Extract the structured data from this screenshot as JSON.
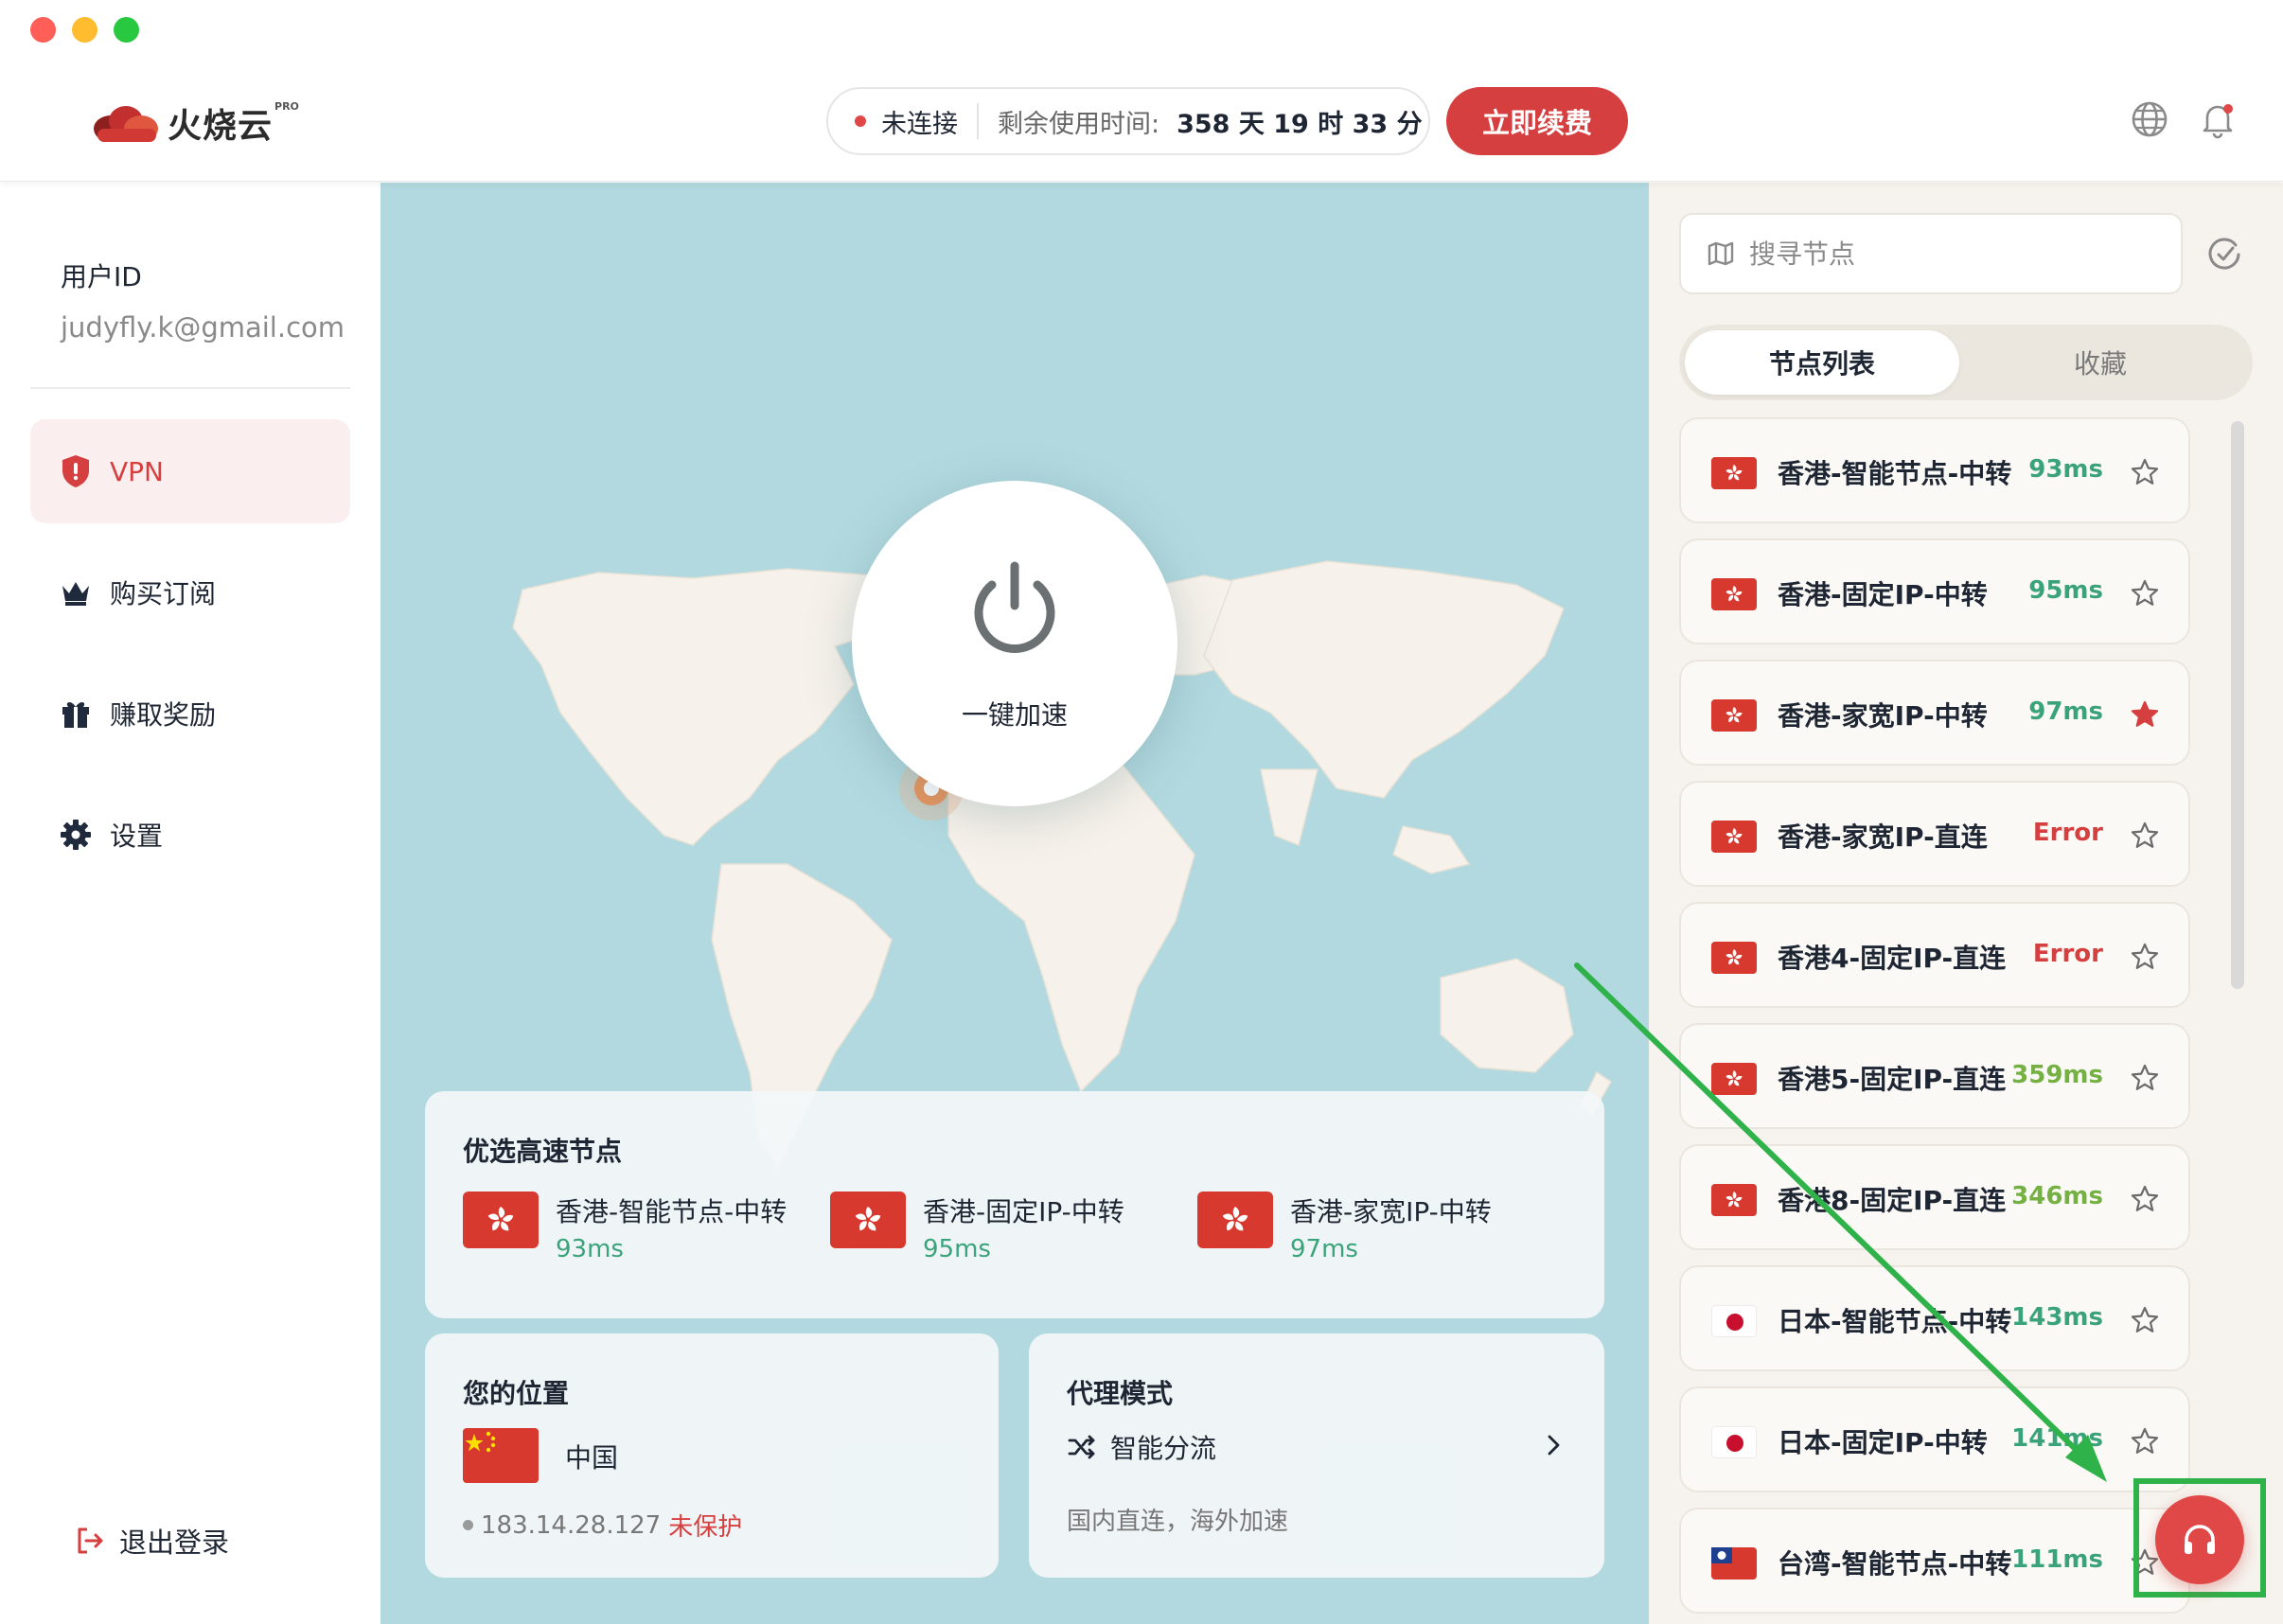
{
  "app": {
    "brand_name": "火烧云",
    "brand_badge": "PRO"
  },
  "header": {
    "status_text": "未连接",
    "remaining_label": "剩余使用时间:",
    "remaining_value": "358 天 19 时 33 分",
    "renew_label": "立即续费",
    "globe_icon": "globe-icon",
    "bell_icon": "bell-icon"
  },
  "sidebar": {
    "user_id_label": "用户ID",
    "user_email": "judyfly.k@gmail.com",
    "items": [
      {
        "label": "VPN",
        "icon": "shield-icon",
        "active": true
      },
      {
        "label": "购买订阅",
        "icon": "crown-icon",
        "active": false
      },
      {
        "label": "赚取奖励",
        "icon": "gift-icon",
        "active": false
      },
      {
        "label": "设置",
        "icon": "gear-icon",
        "active": false
      }
    ],
    "logout_label": "退出登录"
  },
  "main": {
    "power_label": "一键加速",
    "favorites": {
      "title": "优选高速节点",
      "items": [
        {
          "name": "香港-智能节点-中转",
          "latency": "93ms"
        },
        {
          "name": "香港-固定IP-中转",
          "latency": "95ms"
        },
        {
          "name": "香港-家宽IP-中转",
          "latency": "97ms"
        }
      ]
    },
    "location": {
      "title": "您的位置",
      "country": "中国",
      "ip": "183.14.28.127",
      "status": "未保护"
    },
    "mode": {
      "title": "代理模式",
      "value": "智能分流",
      "subtitle": "国内直连，海外加速"
    }
  },
  "right_panel": {
    "search_placeholder": "搜寻节点",
    "tabs": [
      "节点列表",
      "收藏"
    ],
    "nodes": [
      {
        "flag": "hk",
        "name": "香港-智能节点-中转",
        "latency": "93ms",
        "latency_class": "good",
        "starred": false
      },
      {
        "flag": "hk",
        "name": "香港-固定IP-中转",
        "latency": "95ms",
        "latency_class": "good",
        "starred": false
      },
      {
        "flag": "hk",
        "name": "香港-家宽IP-中转",
        "latency": "97ms",
        "latency_class": "good",
        "starred": true
      },
      {
        "flag": "hk",
        "name": "香港-家宽IP-直连",
        "latency": "Error",
        "latency_class": "err",
        "starred": false
      },
      {
        "flag": "hk",
        "name": "香港4-固定IP-直连",
        "latency": "Error",
        "latency_class": "err",
        "starred": false
      },
      {
        "flag": "hk",
        "name": "香港5-固定IP-直连",
        "latency": "359ms",
        "latency_class": "mid",
        "starred": false
      },
      {
        "flag": "hk",
        "name": "香港8-固定IP-直连",
        "latency": "346ms",
        "latency_class": "mid",
        "starred": false
      },
      {
        "flag": "jp",
        "name": "日本-智能节点-中转",
        "latency": "143ms",
        "latency_class": "good",
        "starred": false
      },
      {
        "flag": "jp",
        "name": "日本-固定IP-中转",
        "latency": "141ms",
        "latency_class": "good",
        "starred": false
      },
      {
        "flag": "tw",
        "name": "台湾-智能节点-中转",
        "latency": "111ms",
        "latency_class": "good",
        "starred": false
      }
    ]
  },
  "colors": {
    "accent": "#d63f3f",
    "map_water": "#b1d9df",
    "map_land": "#f6f1ea",
    "latency_good": "#3aa37a",
    "latency_mid": "#74b042",
    "annotation": "#2fb24a"
  }
}
